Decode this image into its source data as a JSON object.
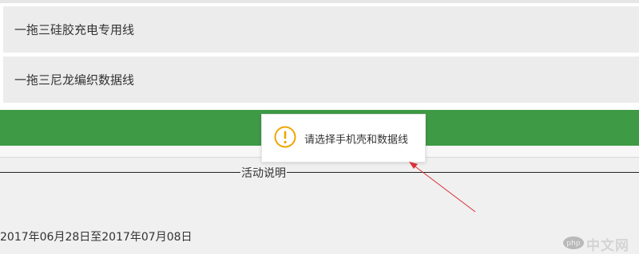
{
  "options": [
    {
      "label": "一拖三硅胶充电专用线"
    },
    {
      "label": "一拖三尼龙编织数据线"
    }
  ],
  "activity": {
    "title": "活动说明",
    "date_range": "2017年06月28日至2017年07月08日"
  },
  "toast": {
    "icon": "warning-icon",
    "message": "请选择手机壳和数据线",
    "icon_color": "#f0a500"
  },
  "colors": {
    "green_bar": "#3f9a45",
    "arrow": "#d9303a"
  },
  "watermark": {
    "text": "中文网",
    "logo_text": "php"
  }
}
